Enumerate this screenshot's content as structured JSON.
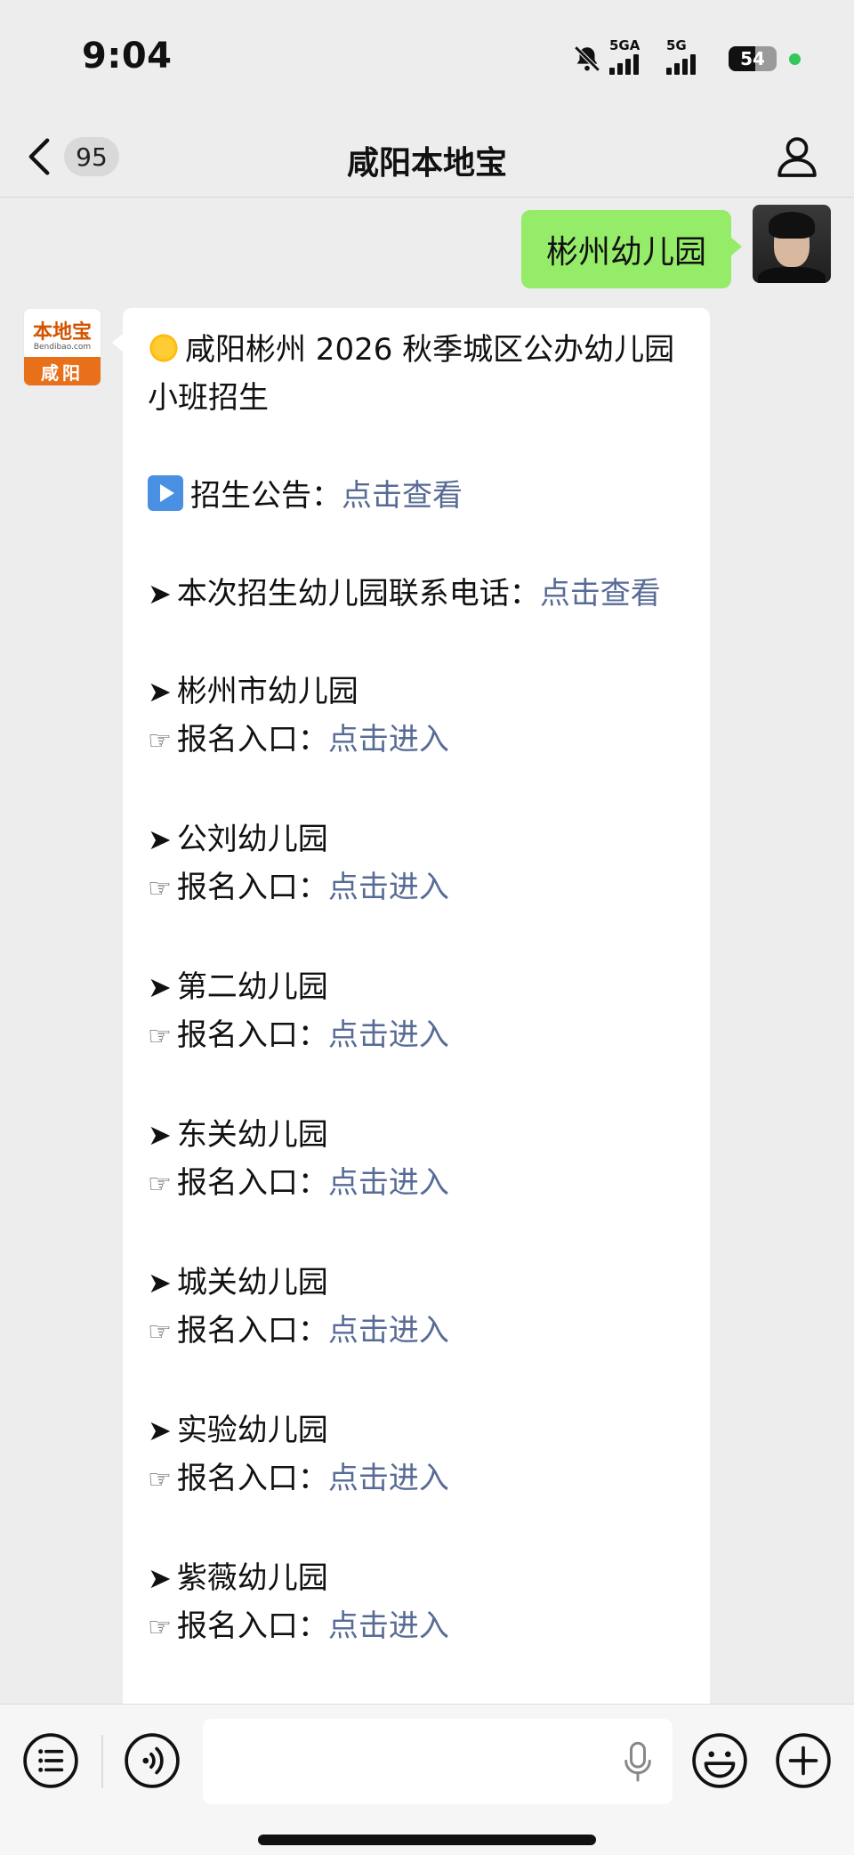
{
  "status_bar": {
    "time": "9:04",
    "network_1": "5GA",
    "network_2": "5G",
    "battery": "54"
  },
  "nav": {
    "unread_count": "95",
    "title": "咸阳本地宝"
  },
  "sent_message": {
    "text": "彬州幼儿园"
  },
  "bot_avatar": {
    "top": "本地宝",
    "site": "Bendibao.com",
    "bottom": "咸阳"
  },
  "message": {
    "heading": "咸阳彬州 2026 秋季城区公办幼儿园小班招生",
    "notice_label": "招生公告：",
    "notice_link": "点击查看",
    "contact_label": "本次招生幼儿园联系电话：",
    "contact_link": "点击查看",
    "entry_label": "报名入口：",
    "entry_link": "点击进入",
    "kindergartens": [
      {
        "name": "彬州市幼儿园"
      },
      {
        "name": "公刘幼儿园"
      },
      {
        "name": "第二幼儿园"
      },
      {
        "name": "东关幼儿园"
      },
      {
        "name": "城关幼儿园"
      },
      {
        "name": "实验幼儿园"
      },
      {
        "name": "紫薇幼儿园"
      }
    ]
  },
  "icons": {
    "mute": "bell-slash-icon",
    "back": "chevron-left-icon",
    "profile": "person-icon",
    "menu": "list-icon",
    "voice": "voice-icon",
    "mic": "microphone-icon",
    "emoji": "emoji-icon",
    "add": "plus-icon"
  },
  "colors": {
    "sent_bubble": "#95ec69",
    "link": "#576b95",
    "background": "#ededed"
  }
}
